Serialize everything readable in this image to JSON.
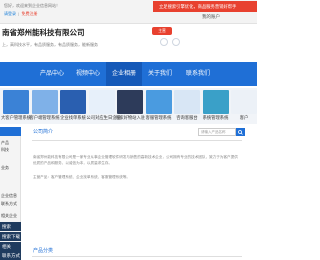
{
  "topbar": {
    "line1": "您好，欢迎来到企业信息网站！",
    "line2_a": "请登录",
    "line2_b": "免费注册",
    "promo": "立足搜索引擎优化，商品服务营销好帮手",
    "user": "我的账户"
  },
  "header": {
    "company": "南省郑州能科技有限公司",
    "intro": "上，高科技水平，有品质服务，有品质服务，能新服务",
    "button": "主营"
  },
  "nav": {
    "items": [
      "产品中心",
      "视频中心",
      "企业相册",
      "关于我们",
      "联系我们"
    ]
  },
  "products": [
    {
      "label": "大客户管理系统",
      "color": "#3b82d6"
    },
    {
      "label": "客户端管理系统",
      "color": "#7fb1e8"
    },
    {
      "label": "企业找单系统",
      "color": "#2a5fb0"
    },
    {
      "label": "公司对应生日企业",
      "color": "#e7f0fa"
    },
    {
      "label": "商家好物站入驻",
      "color": "#2d3b5a"
    },
    {
      "label": "客服管理系统",
      "color": "#4a9be0"
    },
    {
      "label": "咨询客服台",
      "color": "#d8e6f5"
    },
    {
      "label": "系统管理系统",
      "color": "#3aa0c8"
    },
    {
      "label": "客户",
      "color": "#ecf1f7"
    }
  ],
  "sidebar": {
    "items": [
      "产品",
      "科技",
      "业务",
      "企业信息",
      "联系方式",
      "相关企业"
    ],
    "dark": [
      "搜索",
      "搜索下载",
      "相关",
      "联系方式"
    ]
  },
  "main": {
    "about_title": "公司简介",
    "search_placeholder": "请输入产品名称",
    "about_text": "南省郑州能科技有限公司是一家专业从事企业管理软件研发与销售的高新技术企业，公司拥有专业的技术团队，致力于为客户提供优质的产品和服务，以诚信为本，以质量求生存。",
    "about_text2": "主营产品：客户管理系统、企业找单系统、客服管理系统等。",
    "products_title": "产品分类"
  }
}
